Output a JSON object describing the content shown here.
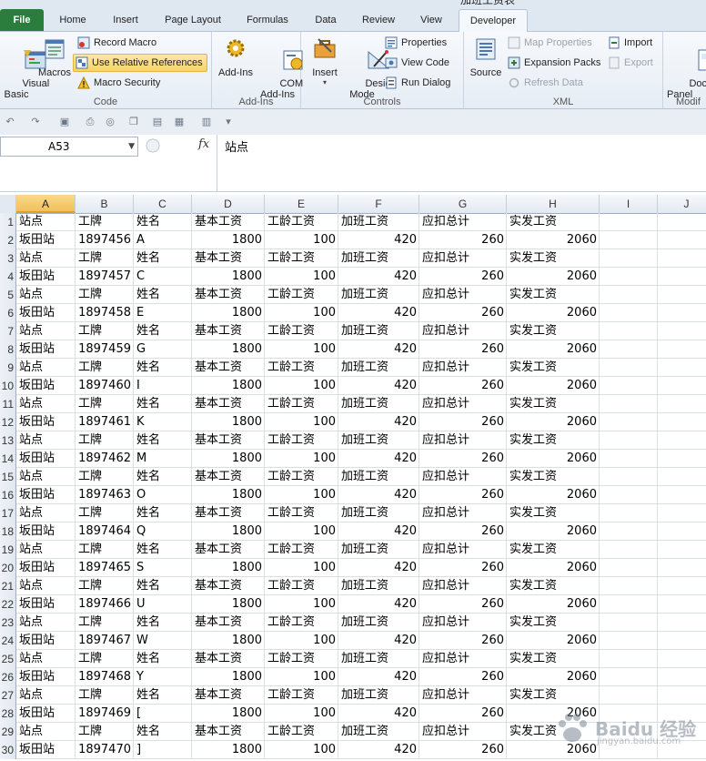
{
  "title_fragment": "加班工资表",
  "tabs": [
    "File",
    "Home",
    "Insert",
    "Page Layout",
    "Formulas",
    "Data",
    "Review",
    "View",
    "Developer"
  ],
  "active_tab": "Developer",
  "ribbon": {
    "code": {
      "label": "Code",
      "visual_basic": "Visual\nBasic",
      "macros": "Macros",
      "record_macro": "Record Macro",
      "use_relative": "Use Relative References",
      "macro_security": "Macro Security"
    },
    "addins": {
      "label": "Add-Ins",
      "add_ins": "Add-Ins",
      "com_add_ins": "COM\nAdd-Ins"
    },
    "controls": {
      "label": "Controls",
      "insert": "Insert",
      "design_mode": "Design\nMode",
      "properties": "Properties",
      "view_code": "View Code",
      "run_dialog": "Run Dialog"
    },
    "xml": {
      "label": "XML",
      "source": "Source",
      "map_properties": "Map Properties",
      "expansion_packs": "Expansion Packs",
      "refresh_data": "Refresh Data",
      "import": "Import",
      "export": "Export"
    },
    "modify": {
      "label": "Modif",
      "document_panel": "Docume\nPanel"
    }
  },
  "formula_bar": {
    "name_box": "A53",
    "fx": "fx",
    "content": "站点"
  },
  "columns": [
    "A",
    "B",
    "C",
    "D",
    "E",
    "F",
    "G",
    "H",
    "I",
    "J"
  ],
  "selected_column": "A",
  "header_row": [
    "站点",
    "工牌",
    "姓名",
    "基本工资",
    "工龄工资",
    "加班工资",
    "应扣总计",
    "实发工资"
  ],
  "data_rows": [
    {
      "station": "坂田站",
      "badge": "1897456",
      "name": "A",
      "base": "1800",
      "seniority": "100",
      "overtime": "420",
      "deduction": "260",
      "net": "2060"
    },
    {
      "station": "坂田站",
      "badge": "1897457",
      "name": "C",
      "base": "1800",
      "seniority": "100",
      "overtime": "420",
      "deduction": "260",
      "net": "2060"
    },
    {
      "station": "坂田站",
      "badge": "1897458",
      "name": "E",
      "base": "1800",
      "seniority": "100",
      "overtime": "420",
      "deduction": "260",
      "net": "2060"
    },
    {
      "station": "坂田站",
      "badge": "1897459",
      "name": "G",
      "base": "1800",
      "seniority": "100",
      "overtime": "420",
      "deduction": "260",
      "net": "2060"
    },
    {
      "station": "坂田站",
      "badge": "1897460",
      "name": "I",
      "base": "1800",
      "seniority": "100",
      "overtime": "420",
      "deduction": "260",
      "net": "2060"
    },
    {
      "station": "坂田站",
      "badge": "1897461",
      "name": "K",
      "base": "1800",
      "seniority": "100",
      "overtime": "420",
      "deduction": "260",
      "net": "2060"
    },
    {
      "station": "坂田站",
      "badge": "1897462",
      "name": "M",
      "base": "1800",
      "seniority": "100",
      "overtime": "420",
      "deduction": "260",
      "net": "2060"
    },
    {
      "station": "坂田站",
      "badge": "1897463",
      "name": "O",
      "base": "1800",
      "seniority": "100",
      "overtime": "420",
      "deduction": "260",
      "net": "2060"
    },
    {
      "station": "坂田站",
      "badge": "1897464",
      "name": "Q",
      "base": "1800",
      "seniority": "100",
      "overtime": "420",
      "deduction": "260",
      "net": "2060"
    },
    {
      "station": "坂田站",
      "badge": "1897465",
      "name": "S",
      "base": "1800",
      "seniority": "100",
      "overtime": "420",
      "deduction": "260",
      "net": "2060"
    },
    {
      "station": "坂田站",
      "badge": "1897466",
      "name": "U",
      "base": "1800",
      "seniority": "100",
      "overtime": "420",
      "deduction": "260",
      "net": "2060"
    },
    {
      "station": "坂田站",
      "badge": "1897467",
      "name": "W",
      "base": "1800",
      "seniority": "100",
      "overtime": "420",
      "deduction": "260",
      "net": "2060"
    },
    {
      "station": "坂田站",
      "badge": "1897468",
      "name": "Y",
      "base": "1800",
      "seniority": "100",
      "overtime": "420",
      "deduction": "260",
      "net": "2060"
    },
    {
      "station": "坂田站",
      "badge": "1897469",
      "name": "[",
      "base": "1800",
      "seniority": "100",
      "overtime": "420",
      "deduction": "260",
      "net": "2060"
    },
    {
      "station": "坂田站",
      "badge": "1897470",
      "name": "]",
      "base": "1800",
      "seniority": "100",
      "overtime": "420",
      "deduction": "260",
      "net": "2060"
    }
  ],
  "row_numbers": [
    "1",
    "2",
    "3",
    "4",
    "5",
    "6",
    "7",
    "8",
    "9",
    "10",
    "11",
    "12",
    "13",
    "14",
    "15",
    "16",
    "17",
    "18",
    "19",
    "20",
    "21",
    "22",
    "23",
    "24",
    "25",
    "26",
    "27",
    "28",
    "29",
    "30"
  ],
  "watermark": {
    "title": "Baidu 经验",
    "sub": "jingyan.baidu.com"
  },
  "colors": {
    "file_tab": "#2a7d3c",
    "selected_col": "#f2c05c",
    "highlight_btn": "#f9d26b"
  }
}
